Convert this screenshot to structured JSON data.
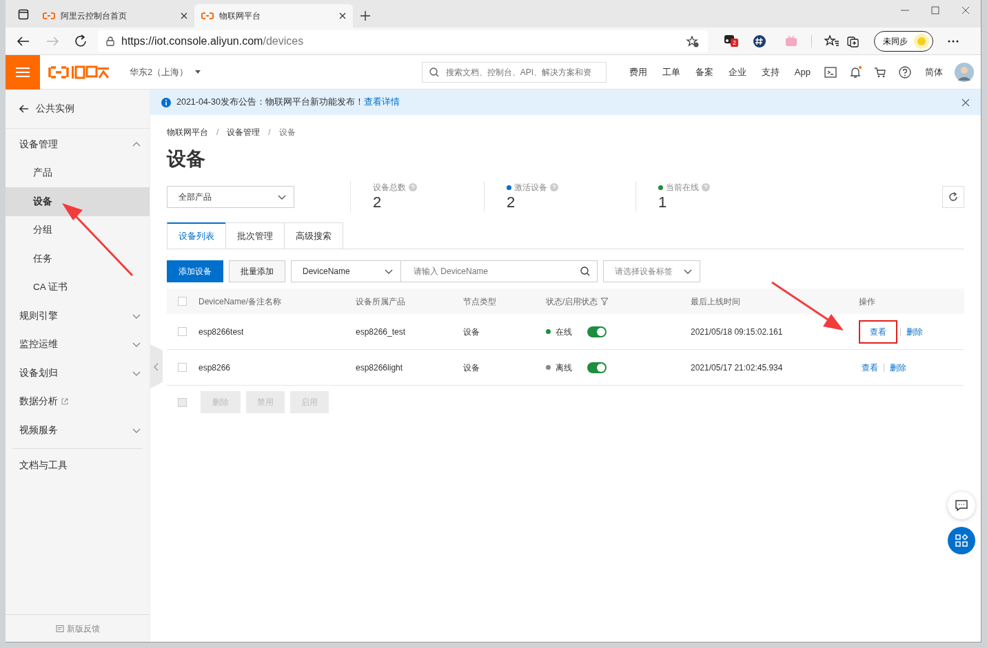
{
  "browser": {
    "tabs": [
      {
        "title": "阿里云控制台首页",
        "selected": false
      },
      {
        "title": "物联网平台",
        "selected": true
      }
    ],
    "url_host": "https://iot.console.aliyun.com",
    "url_path": "/devices",
    "extension_badge": "2",
    "sync_label": "未同步"
  },
  "topbar": {
    "region": "华东2（上海）",
    "search_placeholder": "搜索文档、控制台、API、解决方案和资",
    "links": [
      "费用",
      "工单",
      "备案",
      "企业",
      "支持",
      "App"
    ],
    "language": "简体",
    "has_notification": true
  },
  "sidebar": {
    "back": "公共实例",
    "items": [
      {
        "kind": "group",
        "label": "设备管理",
        "expanded": true,
        "children": [
          {
            "label": "产品",
            "selected": false
          },
          {
            "label": "设备",
            "selected": true
          },
          {
            "label": "分组",
            "selected": false
          },
          {
            "label": "任务",
            "selected": false
          },
          {
            "label": "CA 证书",
            "selected": false
          }
        ]
      },
      {
        "kind": "group",
        "label": "规则引擎",
        "expanded": false
      },
      {
        "kind": "group",
        "label": "监控运维",
        "expanded": false
      },
      {
        "kind": "group",
        "label": "设备划归",
        "expanded": false
      },
      {
        "kind": "external",
        "label": "数据分析"
      },
      {
        "kind": "group",
        "label": "视频服务",
        "expanded": false
      },
      {
        "kind": "divider"
      },
      {
        "kind": "link",
        "label": "文档与工具"
      }
    ],
    "feedback": "新版反馈"
  },
  "notice": {
    "text": "2021-04-30发布公告：物联网平台新功能发布！",
    "link": "查看详情"
  },
  "breadcrumb": [
    {
      "kind": "link",
      "text": "物联网平台"
    },
    {
      "kind": "separator",
      "text": "/"
    },
    {
      "kind": "link",
      "text": "设备管理"
    },
    {
      "kind": "separator",
      "text": "/"
    },
    {
      "kind": "current",
      "text": "设备"
    }
  ],
  "title": "设备",
  "product_select": "全部产品",
  "stats": [
    {
      "label": "设备总数",
      "value": "2"
    },
    {
      "label": "激活设备",
      "value": "2",
      "color": "#0070cc"
    },
    {
      "label": "当前在线",
      "value": "1",
      "color": "#1e8e3e"
    }
  ],
  "tabs": [
    {
      "label": "设备列表",
      "selected": true
    },
    {
      "label": "批次管理",
      "selected": false
    },
    {
      "label": "高级搜索",
      "selected": false
    }
  ],
  "toolbar": {
    "add": "添加设备",
    "batch_add": "批量添加",
    "field": "DeviceName",
    "search_placeholder": "请输入 DeviceName",
    "tag_placeholder": "请选择设备标签"
  },
  "table": {
    "all_checked": false,
    "columns": [
      "DeviceName/备注名称",
      "设备所属产品",
      "节点类型",
      "状态/启用状态",
      "最后上线时间",
      "操作"
    ],
    "rows": [
      {
        "checked": false,
        "name": "esp8266test",
        "product": "esp8266_test",
        "node_type": "设备",
        "status": "在线",
        "online": true,
        "enabled": true,
        "last_online": "2021/05/18 09:15:02.161",
        "actions": [
          {
            "label": "查看",
            "highlighted": true
          },
          {
            "label": "删除",
            "highlighted": false
          }
        ]
      },
      {
        "checked": false,
        "name": "esp8266",
        "product": "esp8266light",
        "node_type": "设备",
        "status": "离线",
        "online": false,
        "enabled": true,
        "last_online": "2021/05/17 21:02:45.934",
        "actions": [
          {
            "label": "查看",
            "highlighted": false
          },
          {
            "label": "删除",
            "highlighted": false
          }
        ]
      }
    ]
  },
  "bulk_select_checked": false,
  "bulk_actions": [
    {
      "label": "删除",
      "disabled": true
    },
    {
      "label": "禁用",
      "disabled": true
    },
    {
      "label": "启用",
      "disabled": true
    }
  ]
}
